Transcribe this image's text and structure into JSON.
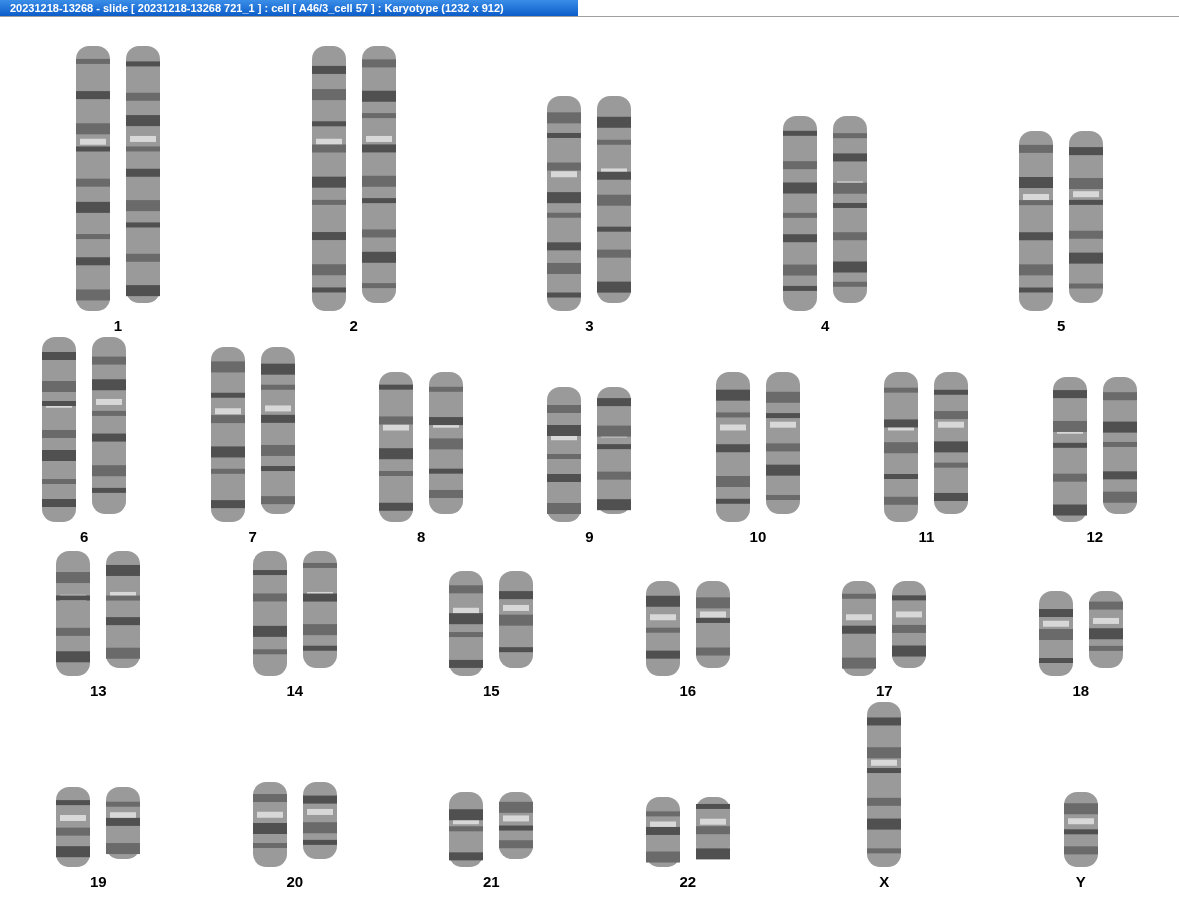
{
  "window": {
    "title": "20231218-13268 - slide [ 20231218-13268 721_1 ] : cell [ A46/3_cell 57 ] : Karyotype  (1232 x 912)"
  },
  "karyotype": {
    "rows": [
      {
        "groups": [
          {
            "label": "1",
            "kind": "pair"
          },
          {
            "label": "2",
            "kind": "pair"
          },
          {
            "label": "3",
            "kind": "pair"
          },
          {
            "label": "4",
            "kind": "pair"
          },
          {
            "label": "5",
            "kind": "pair"
          }
        ]
      },
      {
        "groups": [
          {
            "label": "6",
            "kind": "pair"
          },
          {
            "label": "7",
            "kind": "pair"
          },
          {
            "label": "8",
            "kind": "pair"
          },
          {
            "label": "9",
            "kind": "pair"
          },
          {
            "label": "10",
            "kind": "pair"
          },
          {
            "label": "11",
            "kind": "pair"
          },
          {
            "label": "12",
            "kind": "pair"
          }
        ]
      },
      {
        "groups": [
          {
            "label": "13",
            "kind": "pair"
          },
          {
            "label": "14",
            "kind": "pair"
          },
          {
            "label": "15",
            "kind": "pair"
          },
          {
            "label": "16",
            "kind": "pair"
          },
          {
            "label": "17",
            "kind": "pair"
          },
          {
            "label": "18",
            "kind": "pair"
          }
        ]
      },
      {
        "groups": [
          {
            "label": "19",
            "kind": "pair"
          },
          {
            "label": "20",
            "kind": "pair"
          },
          {
            "label": "21",
            "kind": "pair"
          },
          {
            "label": "22",
            "kind": "pair"
          },
          {
            "label": "X",
            "kind": "single"
          },
          {
            "label": "Y",
            "kind": "single"
          }
        ]
      }
    ]
  }
}
